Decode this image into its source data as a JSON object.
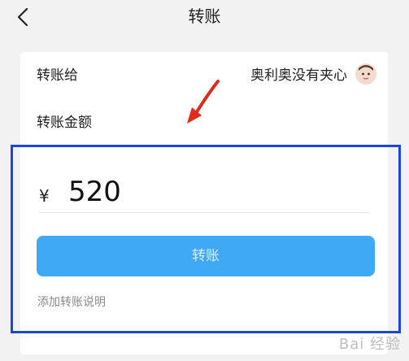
{
  "nav": {
    "title": "转账"
  },
  "recipient": {
    "label": "转账给",
    "name": "奥利奥没有夹心"
  },
  "amount": {
    "label": "转账金额",
    "currency": "¥",
    "value": "520"
  },
  "actions": {
    "transfer_label": "转账",
    "add_note_label": "添加转账说明"
  },
  "watermark": {
    "text": "Bai 经验"
  },
  "colors": {
    "button": "#3fa9f5",
    "highlight_border": "#1d46d6",
    "annotation_arrow": "#e02a1e"
  }
}
